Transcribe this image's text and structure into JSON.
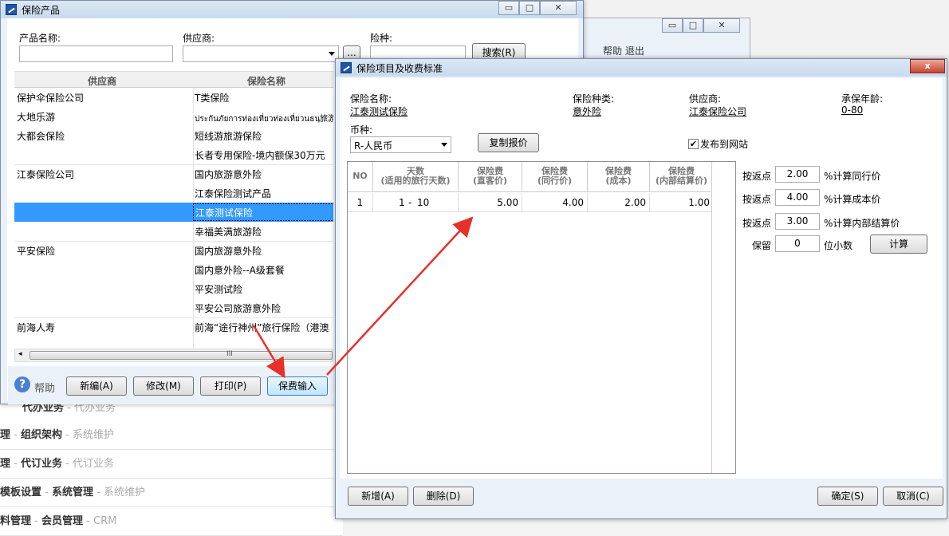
{
  "background": {
    "rows": [
      {
        "bold": "代办业务",
        "mid": "",
        "gray": "代办业务"
      },
      {
        "bold": "理",
        "mid": "组织架构",
        "gray": "系统维护"
      },
      {
        "bold": "理",
        "mid": "代订业务",
        "gray": "代订业务"
      },
      {
        "bold": "模板设置",
        "mid": "系统管理",
        "gray": "系统维护"
      },
      {
        "bold": "料管理",
        "mid": "会员管理",
        "gray": "CRM"
      }
    ],
    "sep": "-",
    "menu": "帮助   退出"
  },
  "product_window": {
    "title": "保险产品",
    "product_name_label": "产品名称:",
    "supplier_label": "供应商:",
    "insurance_type_label": "险种:",
    "ellipsis": "...",
    "search_button": "搜索(R)",
    "columns": [
      "供应商",
      "保险名称"
    ],
    "rows": [
      {
        "supplier": "保护伞保险公司",
        "name": "T类保险"
      },
      {
        "supplier": "大地乐游",
        "name": "ประกันภัยการท่องเที่ยวท่องเที่ยวนธนฺ旅游险"
      },
      {
        "supplier": "大都会保险",
        "name": "短线游旅游保险"
      },
      {
        "supplier": "",
        "name": "长者专用保险-境内额保30万元"
      },
      {
        "supplier": "江泰保险公司",
        "name": "国内旅游意外险"
      },
      {
        "supplier": "",
        "name": "江泰保险测试产品"
      },
      {
        "supplier": "",
        "name": "江泰测试保险",
        "selected": true
      },
      {
        "supplier": "",
        "name": "幸福美满旅游险"
      },
      {
        "supplier": "平安保险",
        "name": "国内旅游意外险"
      },
      {
        "supplier": "",
        "name": "国内意外险--A级套餐"
      },
      {
        "supplier": "",
        "name": "平安测试险"
      },
      {
        "supplier": "",
        "name": "平安公司旅游意外险"
      },
      {
        "supplier": "前海人寿",
        "name": "前海“途行神州”旅行保险（港澳"
      }
    ],
    "scroll_grip": "III",
    "help_label": "帮助",
    "buttons": {
      "new": "新编(A)",
      "edit": "修改(M)",
      "print": "打印(P)",
      "fee_input": "保费输入"
    }
  },
  "fee_window": {
    "title": "保险项目及收费标准",
    "insurance_name_label": "保险名称:",
    "insurance_name": "江泰测试保险",
    "insurance_kind_label": "保险种类:",
    "insurance_kind": "意外险",
    "supplier_label": "供应商:",
    "supplier": "江泰保险公司",
    "age_label": "承保年龄:",
    "age": "0-80",
    "currency_label": "币种:",
    "currency": "R-人民币",
    "copy_quote_button": "复制报价",
    "publish_checked": true,
    "publish_label": "发布到网站",
    "grid_headers": {
      "no": "NO",
      "days": [
        "天数",
        "(适用的旅行天数)"
      ],
      "direct": [
        "保险费",
        "(直客价)"
      ],
      "peer": [
        "保险费",
        "(同行价)"
      ],
      "cost": [
        "保险费",
        "(成本)"
      ],
      "internal": [
        "保险费",
        "(内部结算价)"
      ]
    },
    "grid_rows": [
      {
        "no": "1",
        "day_from": "1",
        "dash": "-",
        "day_to": "10",
        "direct": "5.00",
        "peer": "4.00",
        "cost": "2.00",
        "internal": "1.00"
      }
    ],
    "rebate_label": "按返点",
    "rebate_peer_value": "2.00",
    "rebate_peer_text": "%计算同行价",
    "rebate_cost_value": "4.00",
    "rebate_cost_text": "%计算成本价",
    "rebate_internal_value": "3.00",
    "rebate_internal_text": "%计算内部结算价",
    "keep_label": "保留",
    "keep_value": "0",
    "keep_text": "位小数",
    "calc_button": "计算",
    "buttons": {
      "add": "新增(A)",
      "delete": "删除(D)",
      "ok": "确定(S)",
      "cancel": "取消(C)"
    },
    "close_glyph": "x"
  },
  "colors": {
    "accent": "#3399ff",
    "arrow": "#e8302a"
  }
}
